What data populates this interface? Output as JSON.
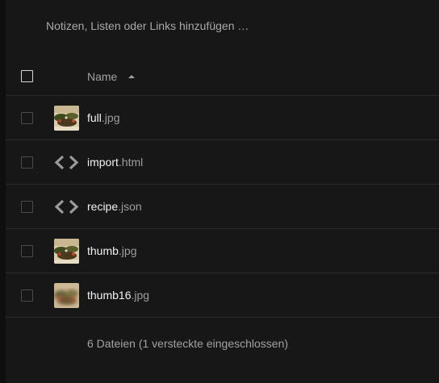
{
  "notes": {
    "placeholder": "Notizen, Listen oder Links hinzufügen …"
  },
  "table": {
    "name_header": "Name",
    "sort": "ascending",
    "files": [
      {
        "base": "full",
        "ext": ".jpg",
        "icon": "image-thumbnail-icon"
      },
      {
        "base": "import",
        "ext": ".html",
        "icon": "code-icon"
      },
      {
        "base": "recipe",
        "ext": ".json",
        "icon": "code-icon"
      },
      {
        "base": "thumb",
        "ext": ".jpg",
        "icon": "image-thumbnail-icon"
      },
      {
        "base": "thumb16",
        "ext": ".jpg",
        "icon": "blurred-thumbnail-icon"
      }
    ]
  },
  "summary": "6 Dateien (1 versteckte eingeschlossen)",
  "colors": {
    "background": "#171717",
    "row_divider": "#2b2b2b",
    "icon_gray": "#9a9a9a"
  }
}
